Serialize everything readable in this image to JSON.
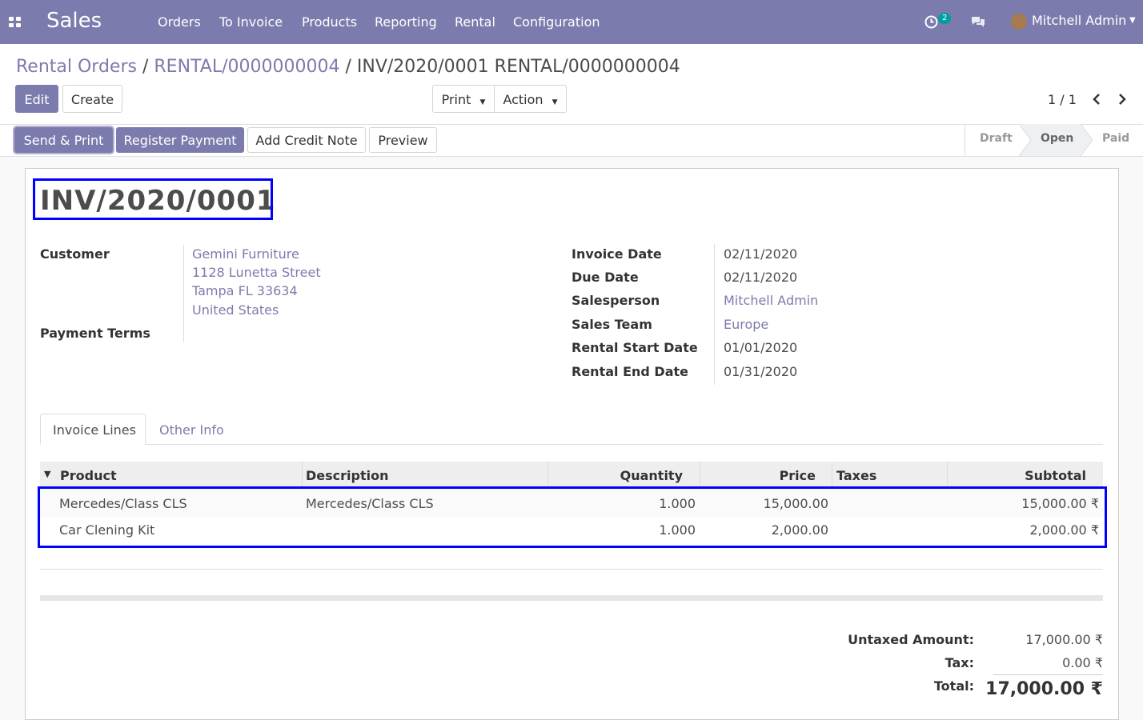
{
  "topbar": {
    "brand": "Sales",
    "menu": [
      "Orders",
      "To Invoice",
      "Products",
      "Reporting",
      "Rental",
      "Configuration"
    ],
    "activity_count": "2",
    "user": "Mitchell Admin"
  },
  "breadcrumb": {
    "items": [
      "Rental Orders",
      "RENTAL/0000000004"
    ],
    "current": "INV/2020/0001 RENTAL/0000000004"
  },
  "buttons": {
    "edit": "Edit",
    "create": "Create",
    "print": "Print",
    "action": "Action",
    "send_print": "Send & Print",
    "register_payment": "Register Payment",
    "add_credit_note": "Add Credit Note",
    "preview": "Preview"
  },
  "pager": "1 / 1",
  "status": [
    "Draft",
    "Open",
    "Paid"
  ],
  "invoice": {
    "title": "INV/2020/0001",
    "customer_label": "Customer",
    "customer": [
      "Gemini Furniture",
      "1128 Lunetta Street",
      "Tampa FL 33634",
      "United States"
    ],
    "payment_terms_label": "Payment Terms",
    "fields": [
      {
        "label": "Invoice Date",
        "value": "02/11/2020"
      },
      {
        "label": "Due Date",
        "value": "02/11/2020"
      },
      {
        "label": "Salesperson",
        "value": "Mitchell Admin"
      },
      {
        "label": "Sales Team",
        "value": "Europe"
      },
      {
        "label": "Rental Start Date",
        "value": "01/01/2020"
      },
      {
        "label": "Rental End Date",
        "value": "01/31/2020"
      }
    ]
  },
  "tabs": [
    "Invoice Lines",
    "Other Info"
  ],
  "lines": {
    "columns": [
      "Product",
      "Description",
      "Quantity",
      "Price",
      "Taxes",
      "Subtotal"
    ],
    "rows": [
      {
        "product": "Mercedes/Class CLS",
        "description": "Mercedes/Class CLS",
        "quantity": "1.000",
        "price": "15,000.00",
        "taxes": "",
        "subtotal": "15,000.00 ₹"
      },
      {
        "product": "Car Clening Kit",
        "description": "",
        "quantity": "1.000",
        "price": "2,000.00",
        "taxes": "",
        "subtotal": "2,000.00 ₹"
      }
    ]
  },
  "totals": {
    "untaxed_label": "Untaxed Amount:",
    "untaxed": "17,000.00 ₹",
    "tax_label": "Tax:",
    "tax": "0.00 ₹",
    "total_label": "Total:",
    "total": "17,000.00 ₹"
  }
}
